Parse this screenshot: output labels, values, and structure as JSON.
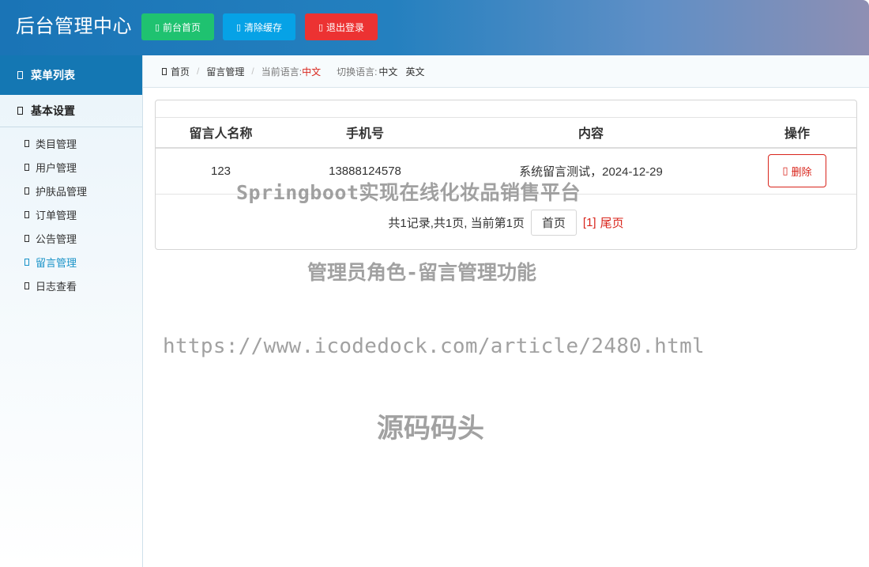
{
  "header": {
    "brand": "后台管理中心",
    "buttons": {
      "front_home": "前台首页",
      "clear_cache": "清除缓存",
      "logout": "退出登录"
    }
  },
  "sidebar": {
    "menu_title": "菜单列表",
    "section_title": "基本设置",
    "items": [
      {
        "label": "类目管理"
      },
      {
        "label": "用户管理"
      },
      {
        "label": "护肤品管理"
      },
      {
        "label": "订单管理"
      },
      {
        "label": "公告管理"
      },
      {
        "label": "留言管理",
        "active": true
      },
      {
        "label": "日志查看"
      }
    ]
  },
  "breadcrumb": {
    "home": "首页",
    "current": "留言管理",
    "current_lang_label": "当前语言:",
    "current_lang": "中文",
    "switch_lang_label": "切换语言:",
    "lang_zh": "中文",
    "lang_en": "英文"
  },
  "table": {
    "headers": [
      "留言人名称",
      "手机号",
      "内容",
      "操作"
    ],
    "rows": [
      {
        "name": "123",
        "phone": "13888124578",
        "content": "系统留言测试，2024-12-29",
        "action": "删除"
      }
    ]
  },
  "pagination": {
    "summary": "共1记录,共1页, 当前第1页",
    "first": "首页",
    "current_page": "[1]",
    "last": "尾页"
  },
  "watermarks": {
    "line1": "Springboot实现在线化妆品销售平台",
    "line2": "管理员角色-留言管理功能",
    "line3": "https://www.icodedock.com/article/2480.html",
    "line4": "源码码头"
  },
  "colors": {
    "accent_blue": "#1477b3",
    "btn_green": "#1fc270",
    "btn_cyan": "#06a2e6",
    "btn_red": "#ec3232",
    "danger": "#d9251c",
    "active_link": "#1a93c8"
  }
}
